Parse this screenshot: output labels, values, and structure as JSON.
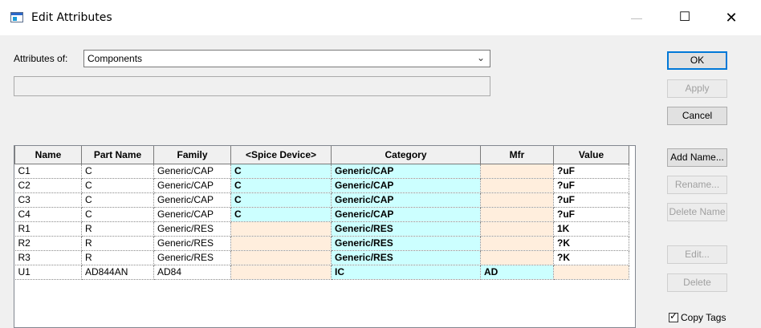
{
  "window": {
    "title": "Edit Attributes",
    "minimize_glyph": "—",
    "maximize_glyph": "☐",
    "close_glyph": "✕",
    "icons": [
      "app-icon",
      "minimize-icon",
      "maximize-icon",
      "close-icon"
    ]
  },
  "attributes_of": {
    "label": "Attributes of:",
    "value": "Components"
  },
  "buttons": {
    "ok": "OK",
    "apply": "Apply",
    "cancel": "Cancel",
    "add_name": "Add Name...",
    "rename": "Rename...",
    "delete_name": "Delete Name",
    "edit": "Edit...",
    "delete": "Delete"
  },
  "copy_tags": {
    "label": "Copy Tags",
    "checked": true
  },
  "colors": {
    "cyan": "#ccffff",
    "peach": "#ffeedd",
    "white": "#ffffff"
  },
  "grid": {
    "columns": [
      "Name",
      "Part Name",
      "Family",
      "<Spice Device>",
      "Category",
      "Mfr",
      "Value"
    ],
    "rows": [
      {
        "cells": [
          "C1",
          "C",
          "Generic/CAP",
          "C",
          "Generic/CAP",
          "",
          "?uF"
        ],
        "colors": [
          "white",
          "white",
          "white",
          "cyan",
          "cyan",
          "peach",
          "white"
        ]
      },
      {
        "cells": [
          "C2",
          "C",
          "Generic/CAP",
          "C",
          "Generic/CAP",
          "",
          "?uF"
        ],
        "colors": [
          "white",
          "white",
          "white",
          "cyan",
          "cyan",
          "peach",
          "white"
        ]
      },
      {
        "cells": [
          "C3",
          "C",
          "Generic/CAP",
          "C",
          "Generic/CAP",
          "",
          "?uF"
        ],
        "colors": [
          "white",
          "white",
          "white",
          "cyan",
          "cyan",
          "peach",
          "white"
        ]
      },
      {
        "cells": [
          "C4",
          "C",
          "Generic/CAP",
          "C",
          "Generic/CAP",
          "",
          "?uF"
        ],
        "colors": [
          "white",
          "white",
          "white",
          "cyan",
          "cyan",
          "peach",
          "white"
        ]
      },
      {
        "cells": [
          "R1",
          "R",
          "Generic/RES",
          "",
          "Generic/RES",
          "",
          "1K"
        ],
        "colors": [
          "white",
          "white",
          "white",
          "peach",
          "cyan",
          "peach",
          "white"
        ]
      },
      {
        "cells": [
          "R2",
          "R",
          "Generic/RES",
          "",
          "Generic/RES",
          "",
          "?K"
        ],
        "colors": [
          "white",
          "white",
          "white",
          "peach",
          "cyan",
          "peach",
          "white"
        ]
      },
      {
        "cells": [
          "R3",
          "R",
          "Generic/RES",
          "",
          "Generic/RES",
          "",
          "?K"
        ],
        "colors": [
          "white",
          "white",
          "white",
          "peach",
          "cyan",
          "peach",
          "white"
        ]
      },
      {
        "cells": [
          "U1",
          "AD844AN",
          "AD84",
          "",
          "IC",
          "AD",
          ""
        ],
        "colors": [
          "white",
          "white",
          "white",
          "peach",
          "cyan",
          "cyan",
          "peach"
        ]
      }
    ]
  }
}
